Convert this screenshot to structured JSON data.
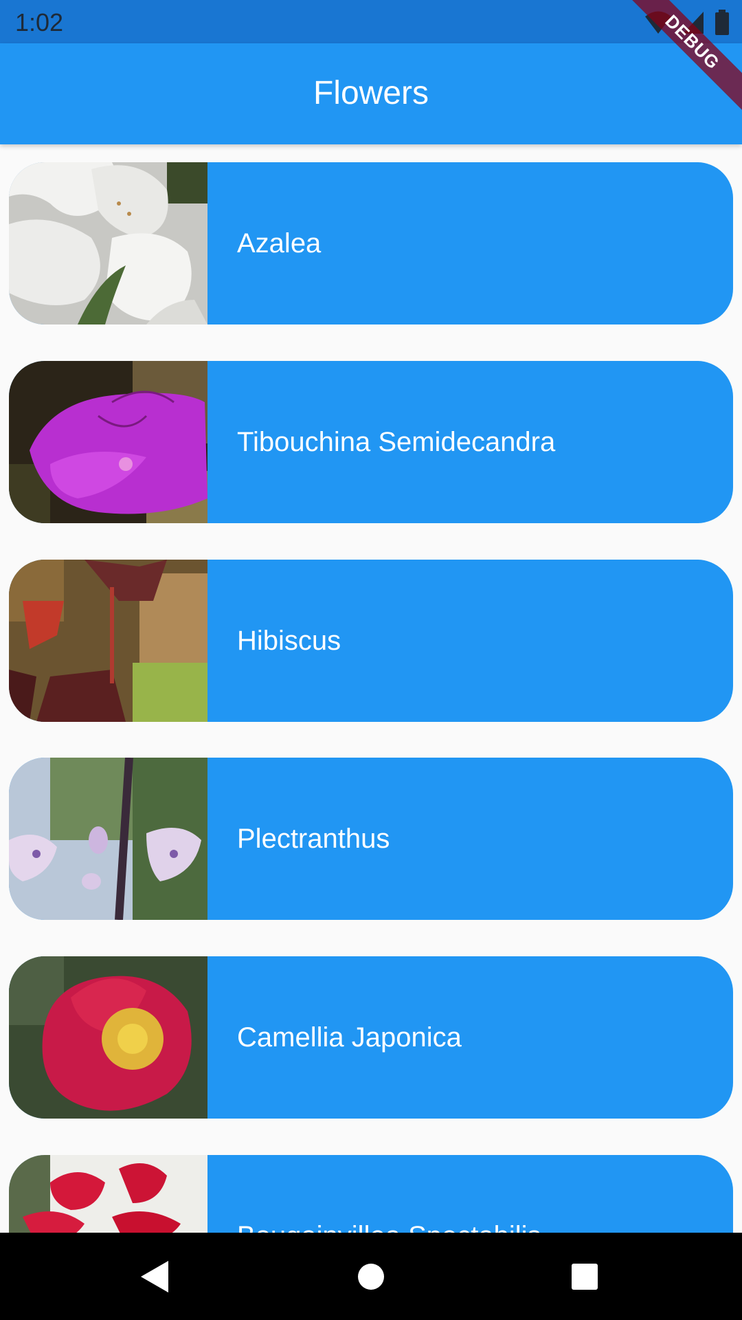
{
  "status_bar": {
    "time": "1:02",
    "icons": [
      "wifi-icon",
      "signal-icon",
      "battery-icon"
    ]
  },
  "app_bar": {
    "title": "Flowers"
  },
  "debug_banner": {
    "label": "DEBUG"
  },
  "flowers": [
    {
      "name": "Azalea",
      "image": "azalea-photo"
    },
    {
      "name": "Tibouchina Semidecandra",
      "image": "tibouchina-photo"
    },
    {
      "name": "Hibiscus",
      "image": "hibiscus-photo"
    },
    {
      "name": "Plectranthus",
      "image": "plectranthus-photo"
    },
    {
      "name": "Camellia Japonica",
      "image": "camellia-photo"
    },
    {
      "name": "Bougainvillea Spectabilis",
      "image": "bougainvillea-photo"
    }
  ],
  "nav_bar": {
    "buttons": [
      "back-icon",
      "home-icon",
      "recents-icon"
    ]
  },
  "colors": {
    "primary": "#2196f3",
    "status_bar": "#1976d2",
    "background": "#fafafa"
  }
}
